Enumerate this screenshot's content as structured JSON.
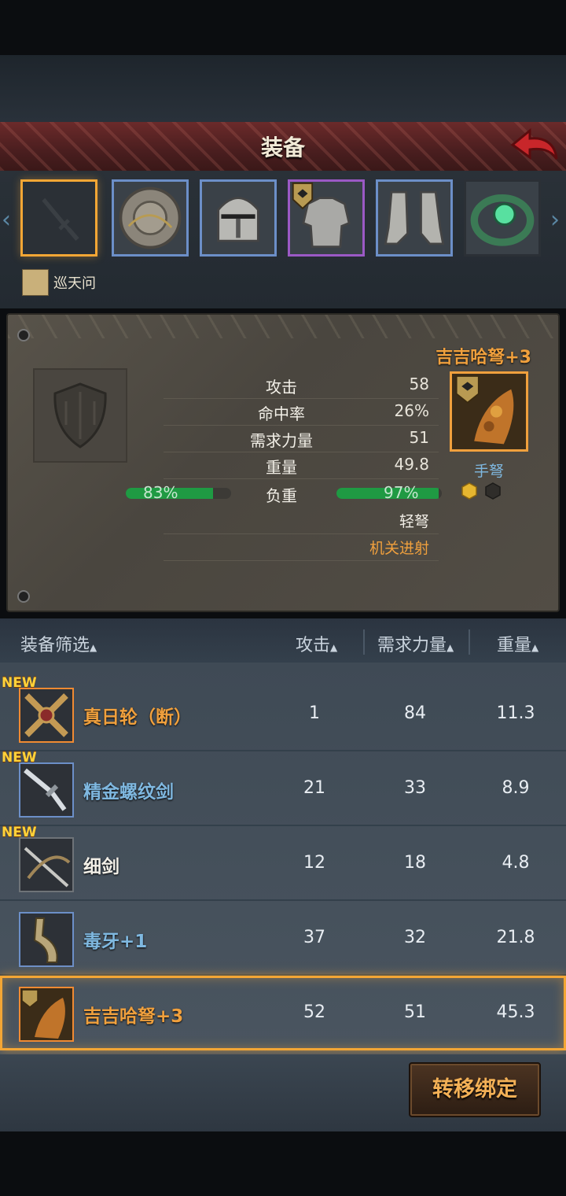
{
  "header": {
    "title": "装备"
  },
  "hero": {
    "name": "巡天问"
  },
  "equipment_slots": [
    {
      "name": "weapon-slot-empty",
      "icon": "sword-icon"
    },
    {
      "name": "shield-slot",
      "icon": "round-shield-icon"
    },
    {
      "name": "helmet-slot",
      "icon": "helmet-icon"
    },
    {
      "name": "armor-slot",
      "icon": "plate-armor-icon"
    },
    {
      "name": "boots-slot",
      "icon": "greaves-icon"
    },
    {
      "name": "ring-slot",
      "icon": "emerald-ring-icon"
    }
  ],
  "stats": {
    "attack_label": "攻击",
    "attack_value": "58",
    "hit_label": "命中率",
    "hit_value": "26%",
    "str_label": "需求力量",
    "str_value": "51",
    "weight_label": "重量",
    "weight_value": "49.8",
    "load_label": "负重",
    "load_left": "83%",
    "load_left_fraction": 0.83,
    "load_right": "97%",
    "load_right_fraction": 0.97,
    "type1": "轻弩",
    "type2": "机关进射"
  },
  "selected_weapon": {
    "name": "吉吉哈弩+3",
    "type": "手弩"
  },
  "filter": {
    "name_label": "装备筛选",
    "attack_label": "攻击",
    "str_label": "需求力量",
    "weight_label": "重量"
  },
  "items": [
    {
      "name": "真日轮（断）",
      "attack": "1",
      "strength": "84",
      "weight": "11.3",
      "new": "NEW"
    },
    {
      "name": "精金螺纹剑",
      "attack": "21",
      "strength": "33",
      "weight": "8.9",
      "new": "NEW"
    },
    {
      "name": "细剑",
      "attack": "12",
      "strength": "18",
      "weight": "4.8",
      "new": "NEW"
    },
    {
      "name": "毒牙+1",
      "attack": "37",
      "strength": "32",
      "weight": "21.8"
    },
    {
      "name": "吉吉哈弩+3",
      "attack": "52",
      "strength": "51",
      "weight": "45.3"
    }
  ],
  "actions": {
    "transfer_bind": "转移绑定"
  },
  "colors": {
    "orange": "#f0a03d",
    "blue": "#7fb8e0",
    "white": "#f2efe7",
    "green": "#1f9a43"
  }
}
